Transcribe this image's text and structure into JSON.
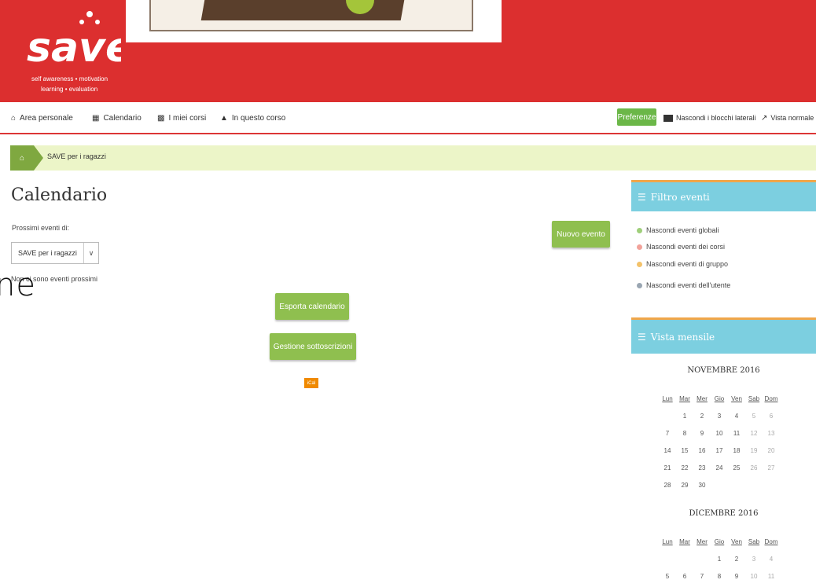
{
  "logo": {
    "word": "save",
    "tagline_line1": "self awareness • motivation",
    "tagline_line2": "learning • evaluation"
  },
  "nav": {
    "items": [
      {
        "icon": "home-icon",
        "label": "Area personale"
      },
      {
        "icon": "calendar-icon",
        "label": "Calendario"
      },
      {
        "icon": "briefcase-icon",
        "label": "I miei corsi"
      },
      {
        "icon": "sitemap-icon",
        "label": "In questo corso"
      }
    ],
    "preferences_label": "Preferenze",
    "hide_blocks_label": "Nascondi i blocchi laterali",
    "normal_view_label": "Vista normale"
  },
  "breadcrumb": {
    "home_icon": "home-icon",
    "current": "SAVE per i ragazzi"
  },
  "main": {
    "title": "Calendario",
    "upcoming_label": "Prossimi eventi di:",
    "course_select": "SAVE per i ragazzi",
    "no_events": "Non ci sono eventi prossimi",
    "overlay_text": "ne",
    "new_event_button": "Nuovo evento",
    "export_button": "Esporta calendario",
    "manage_subscriptions_button": "Gestione sottoscrizioni",
    "ical_label": "iCal"
  },
  "sidebar": {
    "filter_block": {
      "title": "Filtro eventi",
      "items": [
        {
          "label": "Nascondi eventi globali",
          "color": "#9fcf7a"
        },
        {
          "label": "Nascondi eventi dei corsi",
          "color": "#f2a29a"
        },
        {
          "label": "Nascondi eventi di gruppo",
          "color": "#f3c26a"
        },
        {
          "label": "Nascondi eventi dell'utente",
          "color": "#9aa6b2"
        }
      ]
    },
    "month_block": {
      "title": "Vista mensile",
      "weekdays": [
        "Lun",
        "Mar",
        "Mer",
        "Gio",
        "Ven",
        "Sab",
        "Dom"
      ],
      "months": [
        {
          "name": "NOVEMBRE 2016",
          "weeks": [
            [
              "",
              "1",
              "2",
              "3",
              "4",
              "5",
              "6"
            ],
            [
              "7",
              "8",
              "9",
              "10",
              "11",
              "12",
              "13"
            ],
            [
              "14",
              "15",
              "16",
              "17",
              "18",
              "19",
              "20"
            ],
            [
              "21",
              "22",
              "23",
              "24",
              "25",
              "26",
              "27"
            ],
            [
              "28",
              "29",
              "30",
              "",
              "",
              "",
              ""
            ]
          ]
        },
        {
          "name": "DICEMBRE 2016",
          "weeks": [
            [
              "",
              "",
              "",
              "1",
              "2",
              "3",
              "4"
            ],
            [
              "5",
              "6",
              "7",
              "8",
              "9",
              "10",
              "11"
            ]
          ]
        }
      ]
    }
  },
  "colors": {
    "header_red": "#dc2f2f",
    "button_green": "#8fbf4f",
    "block_blue": "#7ccfe0",
    "breadcrumb_bg": "#ecf5c8"
  }
}
